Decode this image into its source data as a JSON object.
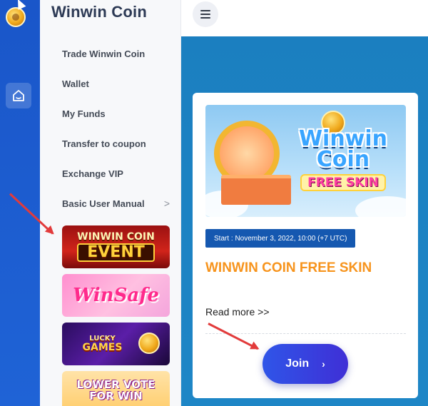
{
  "sidebar": {
    "brand": "Winwin Coin",
    "items": [
      {
        "label": "Trade Winwin Coin"
      },
      {
        "label": "Wallet"
      },
      {
        "label": "My Funds"
      },
      {
        "label": "Transfer to coupon"
      },
      {
        "label": "Exchange VIP"
      },
      {
        "label": "Basic User Manual",
        "chevron": ">"
      }
    ],
    "banners": [
      {
        "name": "winwin-coin-event",
        "line1": "WINWIN COIN",
        "line2": "EVENT"
      },
      {
        "name": "winsafe",
        "line1": "WinSafe"
      },
      {
        "name": "lucky-games",
        "line1": "LUCKY",
        "line2": "GAMES"
      },
      {
        "name": "lower-vote-for-win",
        "line1": "LOWER VOTE",
        "line2": "FOR WIN"
      }
    ]
  },
  "main": {
    "hero": {
      "line1": "Winwin",
      "line2": "Coin",
      "line3": "FREE SKIN"
    },
    "date": "Start : November 3, 2022, 10:00 (+7 UTC)",
    "title": "WINWIN COIN FREE SKIN",
    "read_more": "Read more >>",
    "join": "Join",
    "join_chevron": "›"
  },
  "colors": {
    "rail": "#1a56c9",
    "main_bg": "#1b7fc0",
    "title_orange": "#f7941d",
    "date_badge": "#1558b0",
    "join_button": "#2f55e8",
    "annotation_arrow": "#e23b3b"
  },
  "icons": {
    "rail_logo": "winwin-coin-logo",
    "rail_home": "home-icon",
    "menu": "hamburger-menu-icon",
    "cursor": "mouse-cursor-icon"
  }
}
